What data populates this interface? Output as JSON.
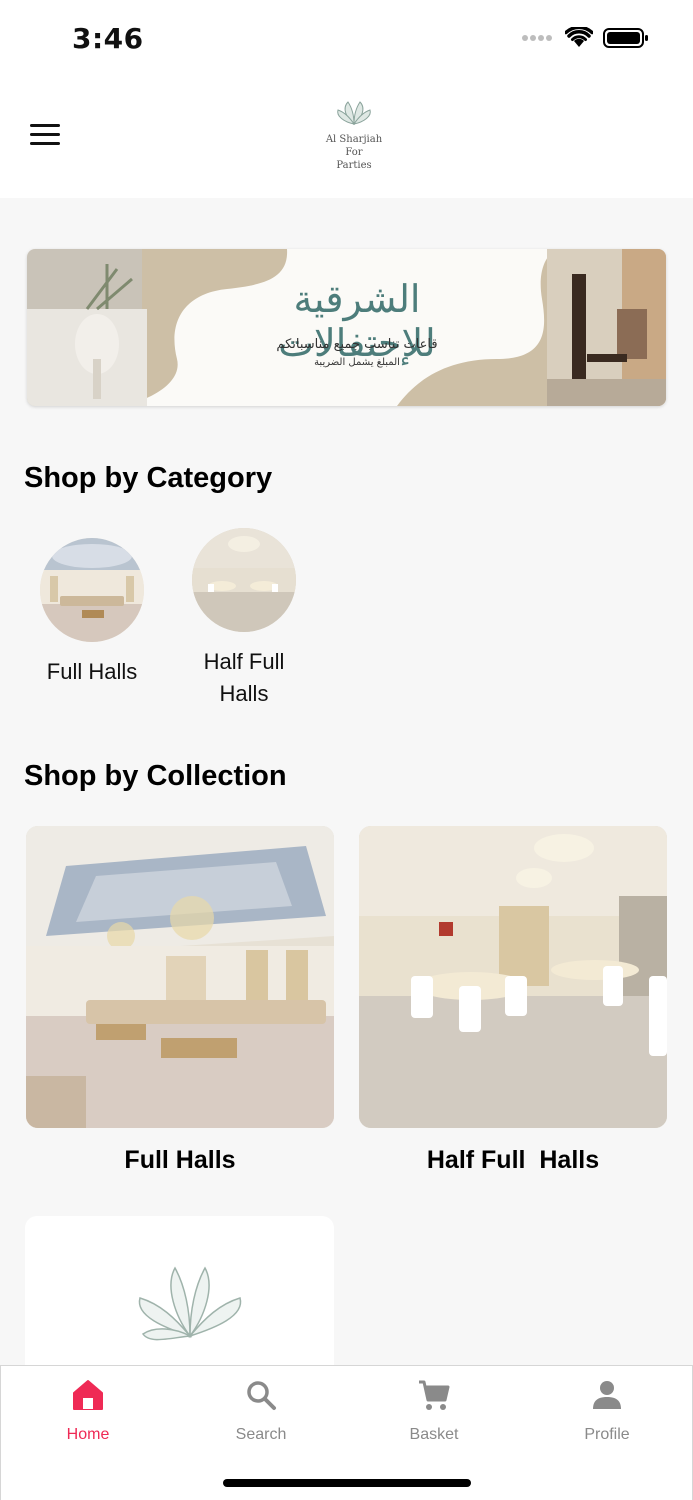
{
  "status_bar": {
    "time": "3:46"
  },
  "header": {
    "logo_line1": "Al Sharjiah For",
    "logo_line2": "Parties"
  },
  "banner": {
    "title": "الشرقية للإحتفالات",
    "subtitle": "قاعات تناسب جميع مناسباتكم",
    "note": "المبلغ يشمل الضريبة"
  },
  "shop_by_category": {
    "title": "Shop by Category",
    "items": [
      {
        "label": "Full Halls"
      },
      {
        "label": "Half Full\nHalls"
      }
    ]
  },
  "shop_by_collection": {
    "title": "Shop by Collection",
    "items": [
      {
        "label": "Full Halls"
      },
      {
        "label": "Half Full  Halls"
      },
      {
        "label": ""
      }
    ]
  },
  "bottom_nav": {
    "items": [
      {
        "label": "Home",
        "icon": "home-icon",
        "active": true
      },
      {
        "label": "Search",
        "icon": "search-icon",
        "active": false
      },
      {
        "label": "Basket",
        "icon": "cart-icon",
        "active": false
      },
      {
        "label": "Profile",
        "icon": "profile-icon",
        "active": false
      }
    ]
  },
  "colors": {
    "accent": "#ef2a55",
    "inactive": "#8a8a8a",
    "banner_teal": "#4d7d7b",
    "banner_beige": "#cdbfa6"
  }
}
